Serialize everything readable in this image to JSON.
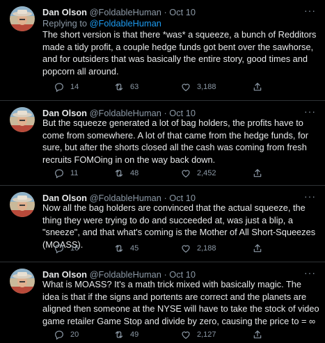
{
  "tweets": [
    {
      "author_name": "Dan Olson",
      "author_handle": "@FoldableHuman",
      "date": "Oct 10",
      "replying_label": "Replying to",
      "replying_handle": "@FoldableHuman",
      "text": "The short version is that there *was* a squeeze, a bunch of Redditors made a tidy profit, a couple hedge funds got bent over the sawhorse, and for outsiders that was basically the entire story, good times and popcorn all around.",
      "replies": "14",
      "retweets": "63",
      "likes": "3,188"
    },
    {
      "author_name": "Dan Olson",
      "author_handle": "@FoldableHuman",
      "date": "Oct 10",
      "text": "But the squeeze generated a lot of bag holders, the profits have to come from somewhere. A lot of that came from the hedge funds, for sure, but after the shorts closed all the cash was coming from fresh recruits FOMOing in on the way back down.",
      "replies": "11",
      "retweets": "48",
      "likes": "2,452"
    },
    {
      "author_name": "Dan Olson",
      "author_handle": "@FoldableHuman",
      "date": "Oct 10",
      "text": "Now all the bag holders are convinced that the actual squeeze, the thing they were trying to do and succeeded at, was just a blip, a \"sneeze\", and that what's coming is the Mother of All Short-Squeezes (MOASS).",
      "replies": "16",
      "retweets": "45",
      "likes": "2,188"
    },
    {
      "author_name": "Dan Olson",
      "author_handle": "@FoldableHuman",
      "date": "Oct 10",
      "text": "What is MOASS? It's a math trick mixed with basically magic. The idea is that if the signs and portents are correct and the planets are aligned then someone at the NYSE will have to take the stock of video game retailer Game Stop and divide by zero, causing the price to = ∞",
      "replies": "20",
      "retweets": "49",
      "likes": "2,127"
    }
  ],
  "separator": " · ",
  "more_glyph": "···",
  "icons": [
    "reply-icon",
    "retweet-icon",
    "like-icon",
    "share-icon",
    "more-icon"
  ],
  "colors": {
    "background": "#000000",
    "text": "#e7e9ea",
    "secondary": "#8b98a5",
    "link": "#1d9bf0",
    "divider": "#2f3336"
  }
}
